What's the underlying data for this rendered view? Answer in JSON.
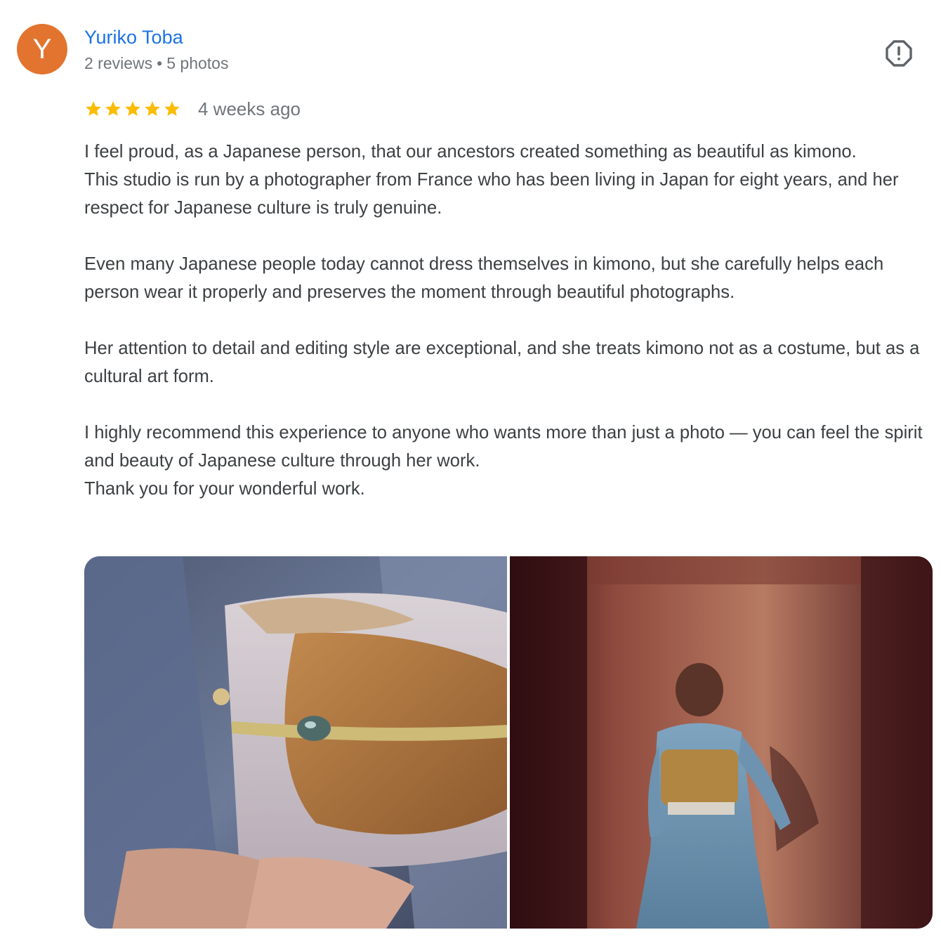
{
  "review": {
    "author": {
      "initial": "Y",
      "name": "Yuriko Toba",
      "reviews": "2 reviews",
      "separator": "•",
      "photos": "5 photos",
      "avatar_color": "#e2742f"
    },
    "rating": 5,
    "star_color": "#fbbc04",
    "date": "4 weeks ago",
    "paragraphs": [
      "I feel proud, as a Japanese person, that our ancestors created something as beautiful as kimono.",
      "This studio is run by a photographer from France who has been living in Japan for eight years, and her respect for Japanese culture is truly genuine.",
      "Even many Japanese people today cannot dress themselves in kimono, but she carefully helps each person wear it properly and preserves the moment through beautiful photographs.",
      "Her attention to detail and editing style are exceptional, and she treats kimono not as a costume, but as a cultural art form.",
      "I highly recommend this experience to anyone who wants more than just a photo — you can feel the spirit and beauty of Japanese culture through her work.",
      "Thank you for your wonderful work."
    ],
    "flag_icon": "report-flag-icon",
    "photo_items": [
      "kimono-obi-closeup-photo",
      "woman-in-kimono-red-wall-photo"
    ]
  }
}
